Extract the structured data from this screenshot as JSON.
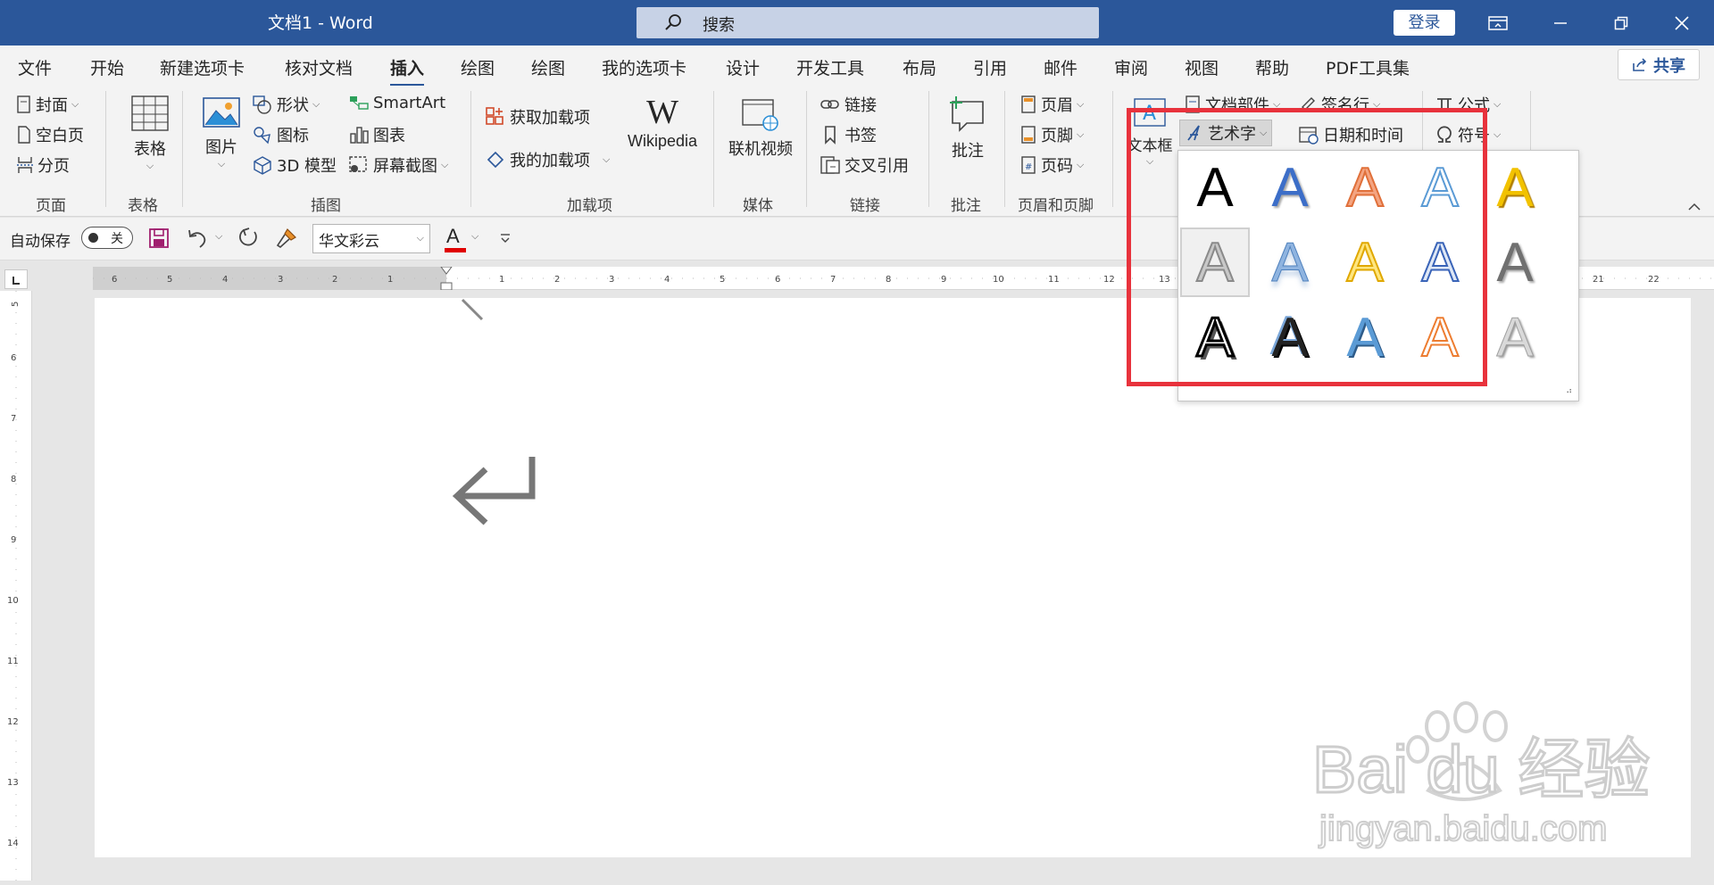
{
  "titlebar": {
    "doc_title": "文档1  -  Word",
    "search_placeholder": "搜索",
    "login": "登录"
  },
  "tabs": [
    "文件",
    "开始",
    "新建选项卡",
    "核对文档",
    "插入",
    "绘图",
    "绘图",
    "我的选项卡",
    "设计",
    "开发工具",
    "布局",
    "引用",
    "邮件",
    "审阅",
    "视图",
    "帮助",
    "PDF工具集"
  ],
  "active_tab": "插入",
  "share": "共享",
  "ribbon": {
    "pages": {
      "cover": "封面",
      "blank": "空白页",
      "break": "分页",
      "label": "页面"
    },
    "tables": {
      "table": "表格",
      "label": "表格"
    },
    "illustrations": {
      "picture": "图片",
      "shapes": "形状",
      "icons": "图标",
      "model3d": "3D 模型",
      "smartart": "SmartArt",
      "chart": "图表",
      "screenshot": "屏幕截图",
      "label": "插图"
    },
    "addins": {
      "get": "获取加载项",
      "my": "我的加载项",
      "wikipedia": "Wikipedia",
      "label": "加载项"
    },
    "media": {
      "video": "联机视频",
      "label": "媒体"
    },
    "links": {
      "link": "链接",
      "bookmark": "书签",
      "crossref": "交叉引用",
      "label": "链接"
    },
    "comments": {
      "comment": "批注",
      "label": "批注"
    },
    "header_footer": {
      "header": "页眉",
      "footer": "页脚",
      "pagenum": "页码",
      "label": "页眉和页脚"
    },
    "text": {
      "textbox": "文本框",
      "quickparts": "文档部件",
      "wordart": "艺术字",
      "signature": "签名行",
      "datetime": "日期和时间"
    },
    "symbols": {
      "equation": "公式",
      "symbol": "符号"
    }
  },
  "qat": {
    "autosave": "自动保存",
    "autosave_state": "关",
    "font": "华文彩云",
    "font_color_glyph": "A"
  },
  "colors": {
    "title_bar": "#2b579a",
    "highlight": "#e8323c",
    "font_color_bar": "#e00000"
  },
  "wordart": {
    "glyph": "A",
    "styles": [
      "black-fill",
      "blue-fill-shadow",
      "orange-outline-fill",
      "blue-outline",
      "gold-fill",
      "gray-outline-selected",
      "blue-gradient-reflection",
      "gold-outline",
      "blue-outline-fill",
      "gray-gradient",
      "black-outline-shadow",
      "black-fill-bevel",
      "blue-fill-bevel",
      "orange-outline-white",
      "silver-gradient"
    ]
  },
  "watermark": {
    "brand": "Bai du 经验",
    "url": "jingyan.baidu.com"
  }
}
